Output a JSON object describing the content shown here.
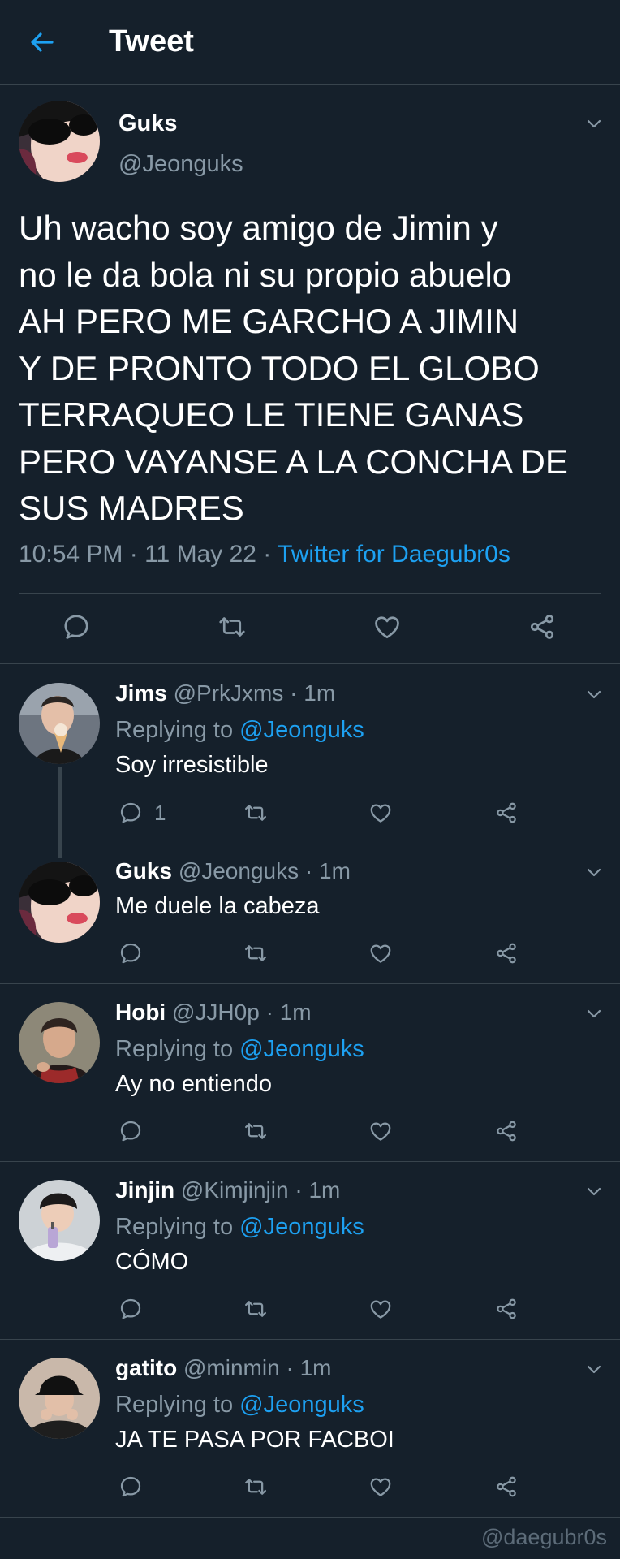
{
  "header": {
    "title": "Tweet"
  },
  "main_tweet": {
    "name": "Guks",
    "handle": "@Jeonguks",
    "text_lines": [
      "Uh wacho soy amigo de Jimin y",
      "no le da bola ni su propio abuelo",
      "AH PERO ME GARCHO A JIMIN",
      "Y DE PRONTO TODO EL GLOBO",
      "TERRAQUEO LE TIENE GANAS",
      "PERO VAYANSE A LA CONCHA DE",
      "SUS MADRES"
    ],
    "time": "10:54 PM",
    "date": "11 May 22",
    "source": "Twitter for Daegubr0s"
  },
  "replies": [
    {
      "name": "Jims",
      "handle": "@PrkJxms",
      "time": "1m",
      "replying_label": "Replying to",
      "replying_to": "@Jeonguks",
      "text": "Soy irresistible",
      "reply_count": "1"
    },
    {
      "name": "Guks",
      "handle": "@Jeonguks",
      "time": "1m",
      "text": "Me duele la cabeza"
    },
    {
      "name": "Hobi",
      "handle": "@JJH0p",
      "time": "1m",
      "replying_label": "Replying to",
      "replying_to": "@Jeonguks",
      "text": "Ay no entiendo"
    },
    {
      "name": "Jinjin",
      "handle": "@Kimjinjin",
      "time": "1m",
      "replying_label": "Replying to",
      "replying_to": "@Jeonguks",
      "text": "CÓMO"
    },
    {
      "name": "gatito",
      "handle": "@minmin",
      "time": "1m",
      "replying_label": "Replying to",
      "replying_to": "@Jeonguks",
      "text": "JA TE PASA POR FACBOI"
    }
  ],
  "watermark": "@daegubr0s",
  "icons": [
    "back-arrow-icon",
    "chevron-down-icon",
    "comment-icon",
    "retweet-icon",
    "like-icon",
    "share-icon"
  ],
  "colors": {
    "background": "#15202b",
    "accent": "#1da1f2",
    "secondary_text": "#8899a6",
    "divider": "#38444d"
  }
}
